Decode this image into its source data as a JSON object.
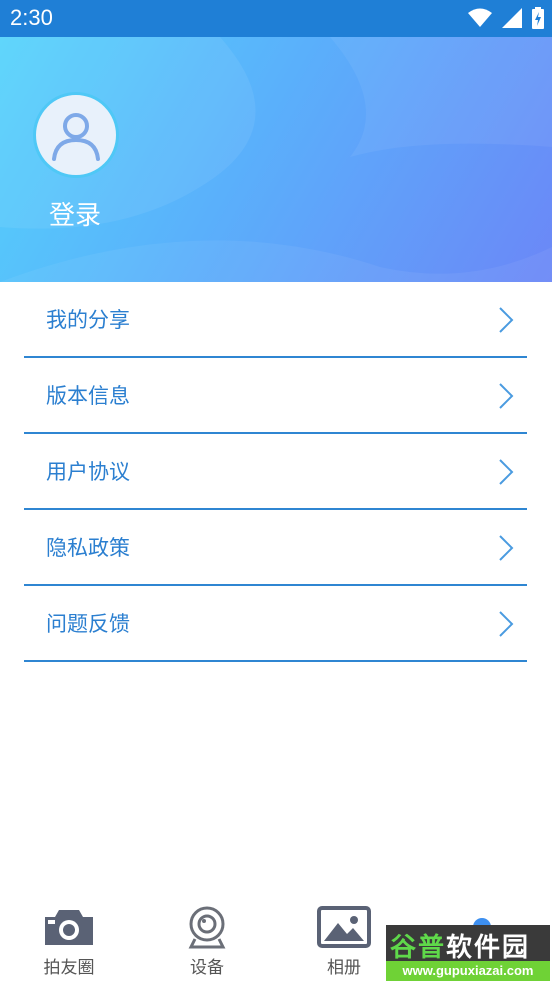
{
  "status_bar": {
    "time": "2:30",
    "icons": [
      "wifi-icon",
      "signal-icon",
      "battery-icon"
    ]
  },
  "header": {
    "avatar_icon": "user-avatar-icon",
    "login_label": "登录",
    "colors": {
      "gradient_start": "#54d3fb",
      "gradient_end": "#6b87f7"
    }
  },
  "menu": {
    "items": [
      {
        "label": "我的分享"
      },
      {
        "label": "版本信息"
      },
      {
        "label": "用户协议"
      },
      {
        "label": "隐私政策"
      },
      {
        "label": "问题反馈"
      }
    ],
    "accent_color": "#2b7fd0"
  },
  "bottom_nav": {
    "items": [
      {
        "label": "拍友圈",
        "icon": "camera-icon"
      },
      {
        "label": "设备",
        "icon": "webcam-icon"
      },
      {
        "label": "相册",
        "icon": "photo-icon"
      },
      {
        "label": "",
        "icon": "profile-icon"
      }
    ]
  },
  "watermark": {
    "brand_part1": "谷普",
    "brand_part2": "软件园",
    "url": "www.gupuxiazai.com"
  }
}
